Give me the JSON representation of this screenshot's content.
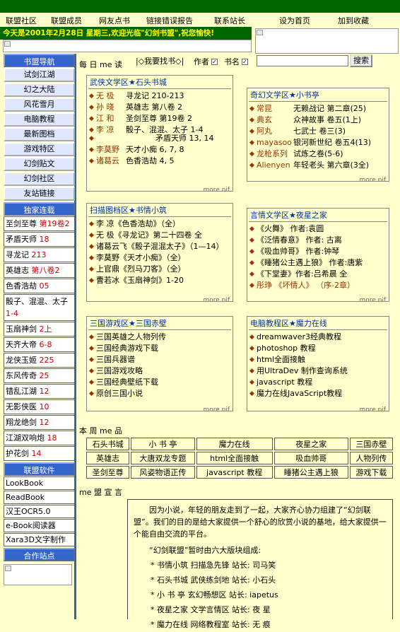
{
  "nav": [
    "联盟社区",
    "联盟成员",
    "网友点书",
    "链接错误报告",
    "联系站长",
    "设为首页",
    "加到收藏"
  ],
  "ticker": "今天是2001年2月28日 星期三,欢迎光临\"幻剑书盟\",祝您愉快!",
  "left": {
    "nav_title": "书盟导航",
    "nav_items": [
      "试剑江湖",
      "幻之大陆",
      "风花雪月",
      "电脑教程",
      "最新图档",
      "游戏特区",
      "幻剑贴文",
      "幻剑社区",
      "友站链接"
    ],
    "serial_title": "独家连载",
    "serials": [
      {
        "name": "至剑至尊",
        "vol": " 第19卷2"
      },
      {
        "name": "矛盾天师",
        "vol": " 18"
      },
      {
        "name": "寻龙记",
        "vol": " 213"
      },
      {
        "name": "英雄志",
        "vol": " 第八卷2"
      },
      {
        "name": "色香浩劫",
        "vol": " 05"
      },
      {
        "name": "骰子、混混、太子",
        "vol": "1-4"
      },
      {
        "name": "玉扇神剑",
        "vol": " 2上"
      },
      {
        "name": "天齐大帝",
        "vol": " 6-8"
      },
      {
        "name": "龙侠玉姬",
        "vol": " 225"
      },
      {
        "name": "东风传奇",
        "vol": " 25"
      },
      {
        "name": "错乱江湖",
        "vol": " 12"
      },
      {
        "name": "无影侠医",
        "vol": " 10"
      },
      {
        "name": "翔龙绝剑",
        "vol": " 12"
      },
      {
        "name": "江湖双响炮",
        "vol": " 18"
      },
      {
        "name": "护花剑",
        "vol": " 14"
      }
    ],
    "soft_title": "联盟软件",
    "soft": [
      "LookBook",
      "ReadBook",
      "汉王OCR5.0",
      "e-Book阅读器",
      "Xara3D文字制作"
    ],
    "partner_title": "合作站点"
  },
  "search": {
    "prefix": "每 日 me 读",
    "find": "|◇我要找书◇|",
    "author": "作者",
    "title": "书名",
    "button": "搜索"
  },
  "boxes": {
    "wuxia": {
      "title": "武侠文学区★石头书城",
      "items": [
        [
          "无 极",
          "寻龙记 210-213"
        ],
        [
          "孙 晓",
          "英雄志 第八卷 2"
        ],
        [
          "江 和",
          "圣剑至尊 第19卷 2"
        ],
        [
          "李 凉",
          "骰子、混混、太子 1-4"
        ],
        [
          "",
          "矛盾天师 13, 14"
        ],
        [
          "李莫野",
          "天才小痴 6, 7, 8"
        ],
        [
          "诸葛云",
          "色香浩劫 4, 5"
        ]
      ],
      "more": "more pif"
    },
    "qihuan": {
      "title": "奇幻文学区★小书亭",
      "items": [
        [
          "常昆",
          "无赖战记 第二章(25)"
        ],
        [
          "典玄",
          "众神故事 卷五(1上)"
        ],
        [
          "阿丸",
          "七武士 卷三(3)"
        ],
        [
          "mayasoo",
          "银河新世纪 卷五4(13)"
        ],
        [
          "龙枪系列",
          "试炼之卷(5-6)"
        ],
        [
          "Alienyen",
          "年轻老头 第六章(3全)"
        ]
      ],
      "more": "more pif"
    },
    "scan": {
      "title": "扫描图档区★书情小筑",
      "items": [
        "李 凉《色香浩劫》（全）",
        "无 极《寻龙记》第二十四卷 全",
        "诸葛云飞《骰子混混太子》（1—14）",
        "李莫野《天才小痴》（全）",
        "上官鼎《烈马刀客》（全）",
        "曹若冰《玉扇神剑》1-20"
      ],
      "more": "more pif"
    },
    "yanqing": {
      "title": "言情文学区★夜星之家",
      "items": [
        "《火舞》 作者:袁圆",
        "《泛情春意》 作者: 古离",
        "《吸血帅哥》 作者:钟琴",
        "《睡猪公主遇上狼》 作者:唐紫",
        "《下堂妻》作者:吕希晨 全",
        "彤琤 《坏情人》 （序-2章）"
      ],
      "more": "more pif"
    },
    "sanguo": {
      "title": "三国游戏区★三国赤壁",
      "items": [
        "三国英雄之人物列传",
        "三国经典游戏下载",
        "三国兵器谱",
        "三国游戏攻略",
        "三国经典壁纸下载",
        "原创三国小说"
      ],
      "more": "more pif"
    },
    "pc": {
      "title": "电脑教程区★魔力在线",
      "items": [
        "dreamwaver3经典教程",
        "photoshop 教程",
        "html全面接触",
        "用UltraDev 制作查询系统",
        "javascript 教程",
        "魔力在线JavaScript教程"
      ],
      "more": "more pif"
    }
  },
  "weekly_title": "本 周 me 品",
  "weekly": [
    [
      "石头书城",
      "小 书 亭",
      "魔力在线",
      "夜星之家",
      "三国赤壁"
    ],
    [
      "英雄志",
      "大唐双龙专题",
      "html全面接触",
      "吸血帅哥",
      "人物列传"
    ],
    [
      "圣剑至尊",
      "风姿物语正传",
      "javascript 教程",
      "睡猪公主遇上狼",
      "游戏下载"
    ]
  ],
  "union_title": "me 盟 宣 言",
  "union": {
    "p1": "因为小说，年轻的朋友走到了一起，大家齐心协力组建了“幻剑联盟”。我们的目的是给大家提供一个舒心的欣赏小说的基地，给大家提供一个能自由交流的平台。",
    "p2": "“幻剑联盟”暂时由六大版块组成:",
    "list": [
      "* 书情小筑 扫描急先锋 站长: 司马笑",
      "* 石头书城 武侠练剑地 站长: 小石头",
      "* 小 书 亭 玄幻畅想区 站长: iapetus",
      "* 夜星之家 文学言情区 站长: 夜 星",
      "* 魔力在线 网络教程室 站长: 无 痕"
    ]
  }
}
